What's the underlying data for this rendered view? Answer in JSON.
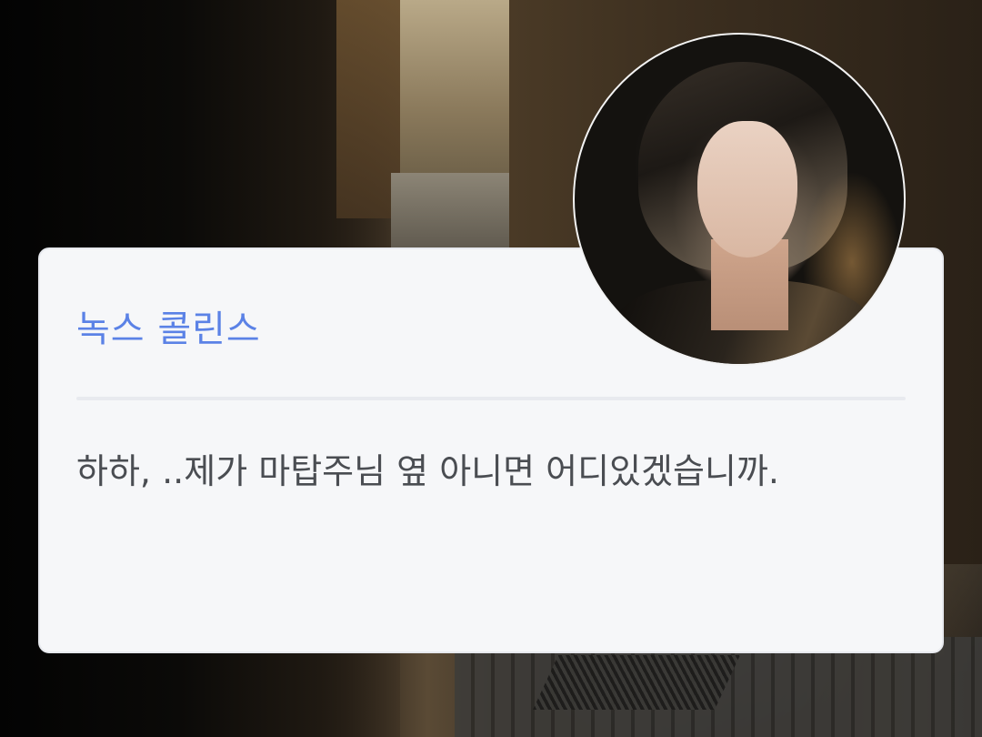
{
  "dialog": {
    "speaker_name": "녹스 콜린스",
    "text": "하하, ..제가 마탑주님 옆 아니면 어디있겠습니까."
  },
  "colors": {
    "speaker_name": "#5b82e6",
    "dialog_text": "#4a4d52",
    "card_background": "#f6f7f9",
    "divider": "#e8eaef"
  },
  "avatar": {
    "icon": "character-portrait"
  }
}
